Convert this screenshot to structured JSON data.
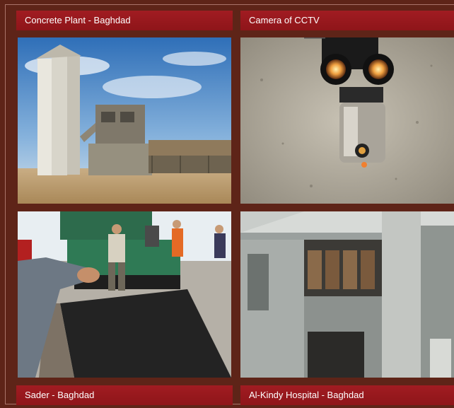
{
  "gallery": {
    "items": [
      {
        "caption": "Concrete Plant - Baghdad",
        "image": "concrete-plant-photo"
      },
      {
        "caption": "Camera of CCTV",
        "image": "cctv-camera-photo"
      },
      {
        "caption": "Sader - Baghdad",
        "image": "road-paving-photo"
      },
      {
        "caption": "Al-Kindy Hospital - Baghdad",
        "image": "hospital-building-photo"
      }
    ]
  },
  "colors": {
    "background": "#5e2418",
    "caption_bar": "#9a1a1f",
    "caption_text": "#ffffff"
  }
}
